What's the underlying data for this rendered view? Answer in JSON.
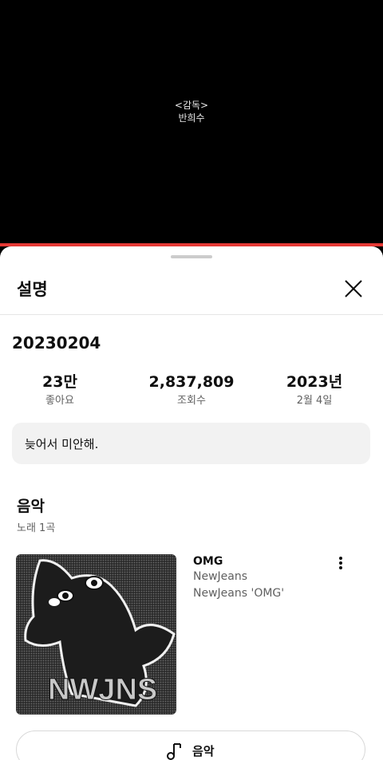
{
  "video": {
    "credit_role": "<감독>",
    "credit_name": "반희수"
  },
  "panel": {
    "title": "설명",
    "close_icon": "close-icon"
  },
  "video_info": {
    "title": "20230204",
    "likes_value": "23만",
    "likes_label": "좋아요",
    "views_value": "2,837,809",
    "views_label": "조회수",
    "year_value": "2023년",
    "date_label": "2월 4일",
    "description": "늦어서 미안해."
  },
  "music": {
    "heading": "음악",
    "count": "노래 1곡",
    "song": {
      "title": "OMG",
      "artist": "NewJeans",
      "album": "NewJeans 'OMG'",
      "art_text": "NWJNS"
    },
    "button_label": "음악"
  },
  "colors": {
    "progress": "#e53935",
    "sheet": "#ffffff",
    "description_bg": "#f2f2f2"
  }
}
